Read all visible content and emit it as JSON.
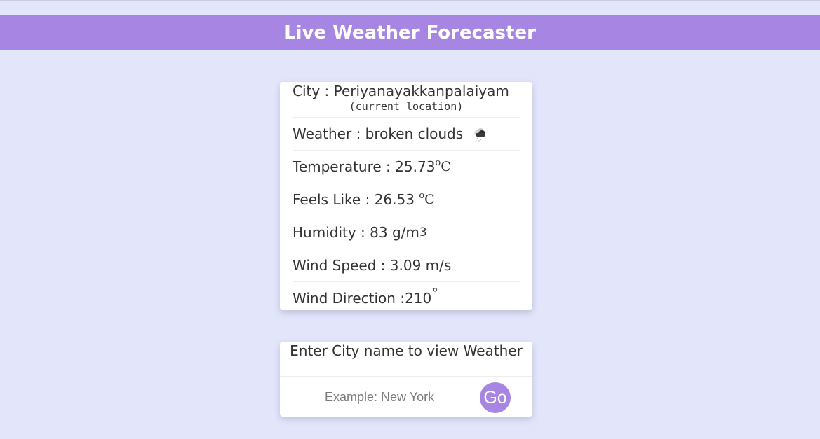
{
  "header": {
    "title": "Live Weather Forecaster"
  },
  "weather": {
    "city_label": "City : ",
    "city": "Periyanayakkanpalaiyam",
    "current_location": "(current location)",
    "weather_label": "Weather : ",
    "description": "broken clouds",
    "weather_icon": "cloud-rain-icon",
    "temperature_label": "Temperature : ",
    "temperature": "25.73",
    "temperature_unit_degree": "o",
    "temperature_unit": "C",
    "feels_like_label": "Feels Like : ",
    "feels_like": "26.53",
    "feels_like_unit_degree": "o",
    "feels_like_unit": "C",
    "humidity_label": "Humidity : ",
    "humidity": "83",
    "humidity_unit": "g/m",
    "humidity_unit_exp": "3",
    "wind_speed_label": "Wind Speed : ",
    "wind_speed": "3.09 m/s",
    "wind_direction_label": "Wind Direction :",
    "wind_direction": "210",
    "wind_direction_unit": "˚"
  },
  "search": {
    "title": "Enter City name to view Weather",
    "placeholder": "Example: New York",
    "value": "",
    "go_label": "Go"
  },
  "colors": {
    "accent": "#a785e3",
    "background": "#e3e6fb",
    "card": "#ffffff",
    "text": "#333333"
  }
}
